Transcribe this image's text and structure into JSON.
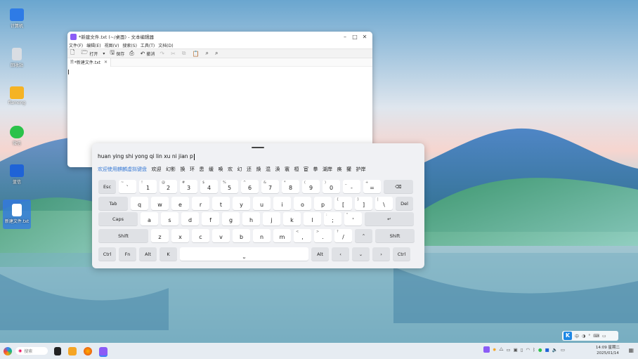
{
  "desktop": {
    "icons": [
      {
        "label": "计算机"
      },
      {
        "label": "回收站"
      },
      {
        "label": "flameng"
      },
      {
        "label": "微信"
      },
      {
        "label": "蓝信"
      },
      {
        "label": "新建文件.txt"
      }
    ]
  },
  "editor": {
    "title": "*新建文件.txt (~/桌面) - 文本编辑器",
    "menu": [
      "文件(F)",
      "编辑(E)",
      "视图(V)",
      "搜索(S)",
      "工具(T)",
      "文档(D)"
    ],
    "toolbar": {
      "open": "打开",
      "save": "保存",
      "undo": "撤消"
    },
    "tab_label": "*新建文件.txt",
    "content": ""
  },
  "keyboard": {
    "pinyin": "huan ying shi yong qi lin xu ni jian p",
    "candidates": [
      "欢迎使用麒麟虚拟键盘",
      "欢迎",
      "幻影",
      "换",
      "环",
      "患",
      "缓",
      "唤",
      "欢",
      "幻",
      "还",
      "焕",
      "混",
      "涣",
      "寰",
      "桓",
      "宦",
      "拳",
      "湖岸",
      "痪",
      "獾",
      "护岸"
    ],
    "rows": [
      [
        {
          "main": "Esc",
          "fn": true
        },
        {
          "sub": "~",
          "main": "`"
        },
        {
          "sub": "!",
          "main": "1"
        },
        {
          "sub": "@",
          "main": "2"
        },
        {
          "sub": "#",
          "main": "3"
        },
        {
          "sub": "$",
          "main": "4"
        },
        {
          "sub": "%",
          "main": "5"
        },
        {
          "sub": "^",
          "main": "6"
        },
        {
          "sub": "&",
          "main": "7"
        },
        {
          "sub": "*",
          "main": "8"
        },
        {
          "sub": "(",
          "main": "9"
        },
        {
          "sub": ")",
          "main": "0"
        },
        {
          "sub": "_",
          "main": "-"
        },
        {
          "sub": "+",
          "main": "="
        },
        {
          "main": "⌫",
          "fn": true
        }
      ],
      [
        {
          "main": "Tab",
          "fn": true
        },
        {
          "main": "q"
        },
        {
          "main": "w"
        },
        {
          "main": "e"
        },
        {
          "main": "r"
        },
        {
          "main": "t"
        },
        {
          "main": "y"
        },
        {
          "main": "u"
        },
        {
          "main": "i"
        },
        {
          "main": "o"
        },
        {
          "main": "p"
        },
        {
          "sub": "{",
          "main": "["
        },
        {
          "sub": "}",
          "main": "]"
        },
        {
          "sub": "|",
          "main": "\\"
        },
        {
          "main": "Del",
          "fn": true
        }
      ],
      [
        {
          "main": "Caps",
          "fn": true
        },
        {
          "main": "a"
        },
        {
          "main": "s"
        },
        {
          "main": "d"
        },
        {
          "main": "f"
        },
        {
          "main": "g"
        },
        {
          "main": "h"
        },
        {
          "main": "j"
        },
        {
          "main": "k"
        },
        {
          "main": "l"
        },
        {
          "sub": ":",
          "main": ";"
        },
        {
          "sub": "\"",
          "main": "'"
        },
        {
          "main": "↵",
          "fn": true
        }
      ],
      [
        {
          "main": "Shift",
          "fn": true
        },
        {
          "main": "z"
        },
        {
          "main": "x"
        },
        {
          "main": "c"
        },
        {
          "main": "v"
        },
        {
          "main": "b"
        },
        {
          "main": "n"
        },
        {
          "main": "m"
        },
        {
          "sub": "<",
          "main": ","
        },
        {
          "sub": ">",
          "main": "."
        },
        {
          "sub": "?",
          "main": "/"
        },
        {
          "main": "⌃",
          "fn": true
        },
        {
          "main": "Shift",
          "fn": true
        }
      ],
      [
        {
          "main": "Ctrl",
          "fn": true
        },
        {
          "main": "Fn",
          "fn": true
        },
        {
          "main": "Alt",
          "fn": true
        },
        {
          "main": "K",
          "fn": true
        },
        {
          "main": "⎵"
        },
        {
          "main": "Alt",
          "fn": true
        },
        {
          "main": "‹",
          "fn": true
        },
        {
          "main": "⌄",
          "fn": true
        },
        {
          "main": "›",
          "fn": true
        },
        {
          "main": "Ctrl",
          "fn": true
        }
      ]
    ]
  },
  "taskbar": {
    "search_placeholder": "搜索",
    "time": "14:09 星期二",
    "date": "2025/01/14"
  },
  "ime_bar": {
    "logo": "K",
    "items": [
      "中",
      "◑",
      "°",
      "⌨",
      "▭"
    ]
  }
}
